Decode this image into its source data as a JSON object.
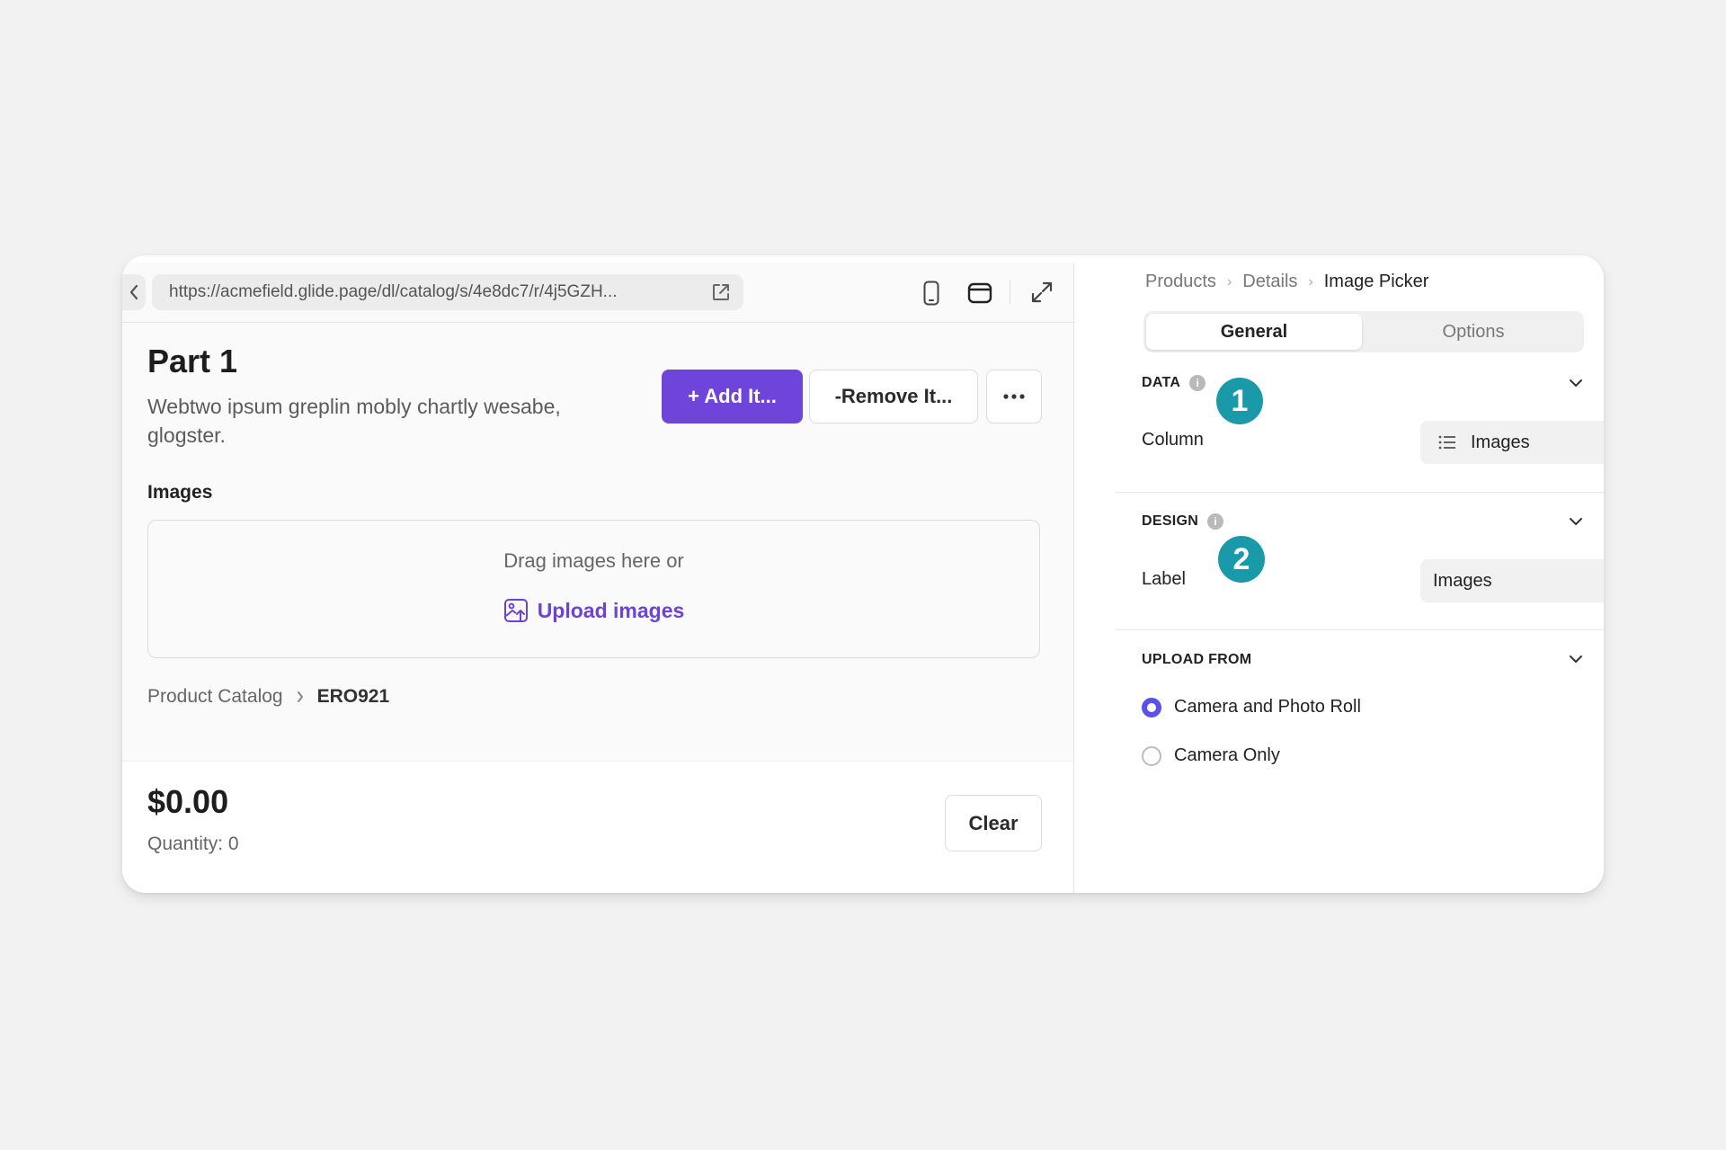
{
  "preview": {
    "url": "https://acmefield.glide.page/dl/catalog/s/4e8dc7/r/4j5GZH...",
    "title": "Part 1",
    "description": "Webtwo ipsum greplin mobly chartly wesabe, glogster.",
    "buttons": {
      "add": "+ Add It...",
      "remove": "-Remove It..."
    },
    "images_label": "Images",
    "dropzone": {
      "text": "Drag images here or",
      "upload": "Upload images"
    },
    "breadcrumb": {
      "parent": "Product Catalog",
      "current": "ERO921"
    },
    "footer": {
      "price": "$0.00",
      "quantity": "Quantity: 0",
      "clear": "Clear"
    }
  },
  "inspector": {
    "breadcrumb": [
      "Products",
      "Details",
      "Image Picker"
    ],
    "tabs": [
      "General",
      "Options"
    ],
    "active_tab": "General",
    "sections": {
      "data": {
        "title": "DATA",
        "badge": "1",
        "column_label": "Column",
        "column_value": "Images"
      },
      "design": {
        "title": "DESIGN",
        "badge": "2",
        "label_label": "Label",
        "label_value": "Images"
      },
      "upload_from": {
        "title": "UPLOAD FROM",
        "options": [
          "Camera and Photo Roll",
          "Camera Only"
        ],
        "selected": "Camera and Photo Roll"
      }
    }
  },
  "colors": {
    "primary": "#6e44db",
    "badge": "#1a9aa8",
    "radio_selected": "#5b50e8"
  },
  "icons": [
    "chevron-left-icon",
    "external-link-icon",
    "phone-icon",
    "tablet-icon",
    "expand-icon",
    "more-icon",
    "image-upload-icon",
    "chevron-right-icon",
    "info-icon",
    "chevron-down-icon",
    "list-icon",
    "kebab-icon"
  ]
}
